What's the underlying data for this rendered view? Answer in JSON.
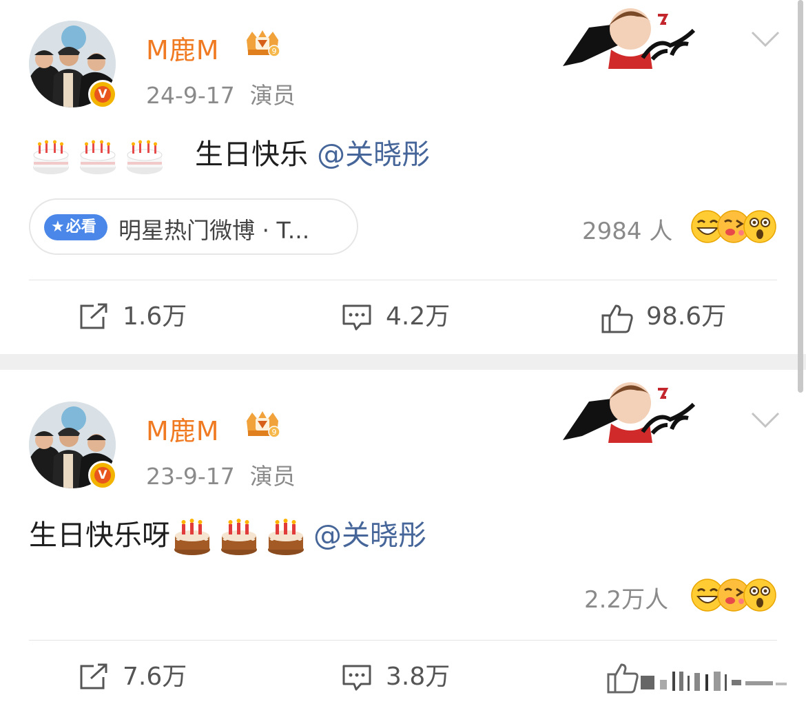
{
  "posts": [
    {
      "author": "M鹿M",
      "date": "24-9-17",
      "role": "演员",
      "emojis": [
        "cake-icon",
        "cake-icon",
        "cake-icon"
      ],
      "text": "生日快乐",
      "mention": "@关晓彤",
      "tag": {
        "badge": "必看",
        "text": "明星热门微博 · T..."
      },
      "reactions": "2984 人",
      "actions": {
        "repost": "1.6万",
        "comment": "4.2万",
        "like": "98.6万"
      }
    },
    {
      "author": "M鹿M",
      "date": "23-9-17",
      "role": "演员",
      "text": "生日快乐呀",
      "emojis": [
        "birthday-cake-icon",
        "birthday-cake-icon",
        "birthday-cake-icon"
      ],
      "mention": "@关晓彤",
      "reactions": "2.2万人",
      "actions": {
        "repost": "7.6万",
        "comment": "3.8万",
        "like": ""
      }
    }
  ],
  "colors": {
    "name": "#f07a22",
    "mention": "#46669a",
    "badge": "#4a87e8",
    "meta": "#8a8a8a"
  }
}
